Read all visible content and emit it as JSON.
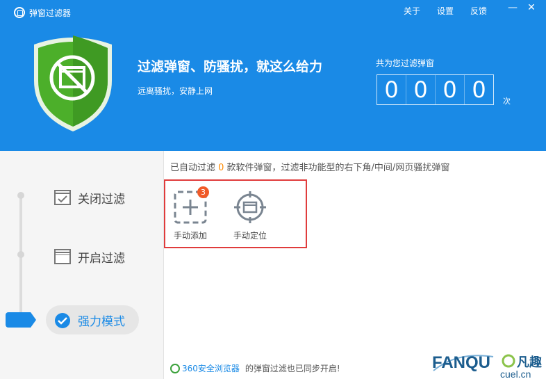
{
  "window": {
    "title": "弹窗过滤器",
    "menu": {
      "about": "关于",
      "settings": "设置",
      "feedback": "反馈"
    },
    "minimize": "—",
    "close": "✕"
  },
  "hero": {
    "headline": "过滤弹窗、防骚扰，就这么给力",
    "subline": "远离骚扰，安静上网",
    "counter_label": "共为您过滤弹窗",
    "digits": [
      "0",
      "0",
      "0",
      "0"
    ],
    "counter_unit": "次"
  },
  "sidebar": {
    "modes": [
      {
        "label": "关闭过滤",
        "icon": "check-window-icon"
      },
      {
        "label": "开启过滤",
        "icon": "window-icon"
      },
      {
        "label": "强力模式",
        "icon": "check-circle-icon",
        "active": true
      }
    ]
  },
  "content": {
    "desc_prefix": "已自动过滤 ",
    "desc_count": "0",
    "desc_suffix": " 款软件弹窗，过滤非功能型的右下角/中间/网页骚扰弹窗",
    "tools": [
      {
        "label": "手动添加",
        "icon": "add-dashed-icon",
        "badge": "3"
      },
      {
        "label": "手动定位",
        "icon": "crosshair-window-icon"
      }
    ]
  },
  "footer": {
    "link": "360安全浏览器",
    "text": "的弹窗过滤也已同步开启!"
  },
  "watermark": {
    "brand": "FANQU",
    "cn": "凡趣",
    "site": "cuel.cn"
  },
  "colors": {
    "accent": "#1a8ae6",
    "shield": "#4caf2a",
    "badge": "#f05a28",
    "highlight_border": "#e03c3c"
  }
}
